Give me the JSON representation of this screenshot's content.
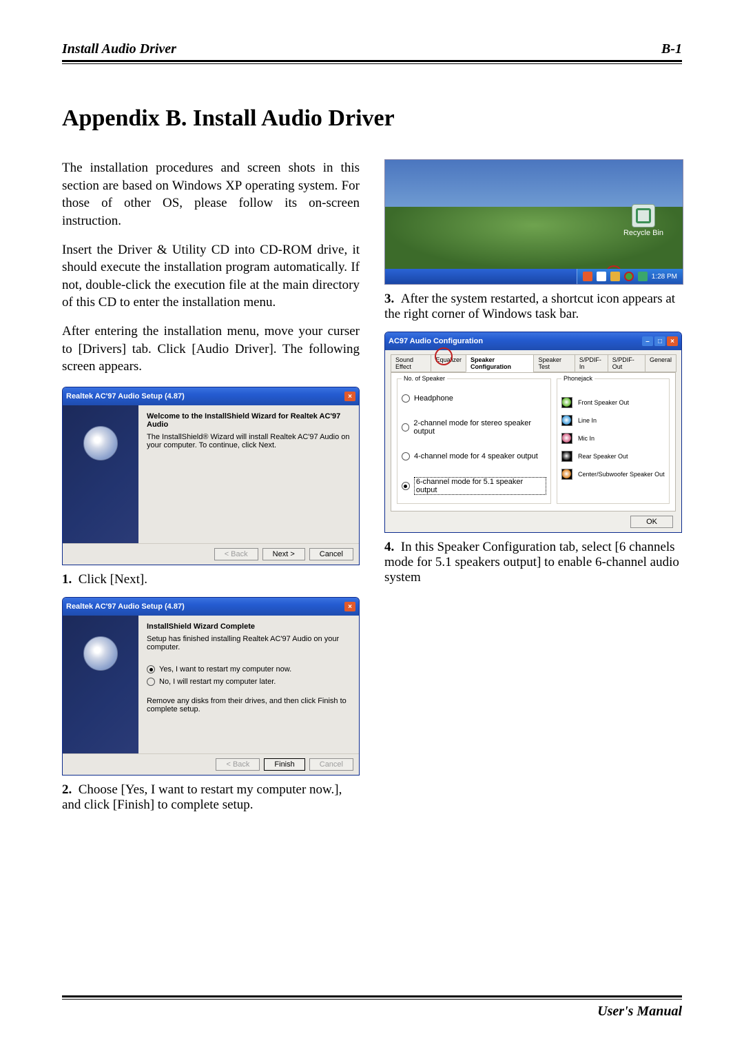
{
  "header": {
    "left": "Install Audio Driver",
    "right": "B-1"
  },
  "title": "Appendix B.   Install Audio Driver",
  "intro": [
    "The installation procedures and screen shots in this section are based on Windows XP operating system. For those of other OS, please follow its on-screen instruction.",
    "Insert the Driver & Utility CD into CD-ROM drive, it should execute the installation program automatically. If not, double-click the execution file at the main directory of this CD to enter the installation menu.",
    "After entering the installation menu, move your curser to [Drivers] tab. Click [Audio Driver]. The following screen appears."
  ],
  "steps": {
    "s1": {
      "num": "1.",
      "text": "Click [Next]."
    },
    "s2": {
      "num": "2.",
      "text": "Choose [Yes, I want to restart my computer now.], and click [Finish] to complete setup."
    },
    "s3": {
      "num": "3.",
      "text": "After the system restarted, a shortcut icon appears at the right corner of Windows task bar."
    },
    "s4": {
      "num": "4.",
      "text": "In this Speaker Configuration tab, select [6 channels mode for 5.1 speakers output] to enable 6-channel audio system"
    }
  },
  "wiz1": {
    "title": "Realtek AC'97 Audio Setup (4.87)",
    "heading": "Welcome to the InstallShield Wizard for Realtek AC'97 Audio",
    "body": "The InstallShield® Wizard will install Realtek AC'97 Audio on your computer. To continue, click Next.",
    "buttons": {
      "back": "< Back",
      "next": "Next >",
      "cancel": "Cancel"
    }
  },
  "wiz2": {
    "title": "Realtek AC'97 Audio Setup (4.87)",
    "heading": "InstallShield Wizard Complete",
    "body": "Setup has finished installing Realtek AC'97 Audio on your computer.",
    "opt_yes": "Yes, I want to restart my computer now.",
    "opt_no": "No, I will restart my computer later.",
    "note": "Remove any disks from their drives, and then click Finish to complete setup.",
    "buttons": {
      "back": "< Back",
      "finish": "Finish",
      "cancel": "Cancel"
    }
  },
  "desktop": {
    "recycle": "Recycle Bin",
    "clock": "1:28 PM"
  },
  "cfg": {
    "title": "AC97 Audio Configuration",
    "tabs": [
      "Sound Effect",
      "Equalizer",
      "Speaker Configuration",
      "Speaker Test",
      "S/PDIF-In",
      "S/PDIF-Out",
      "General"
    ],
    "active_tab": 2,
    "group_left": "No. of Speaker",
    "group_right": "Phonejack",
    "options": {
      "o1": "Headphone",
      "o2": "2-channel mode for stereo speaker output",
      "o3": "4-channel mode for 4 speaker output",
      "o4": "6-channel mode for 5.1 speaker output"
    },
    "jacks": {
      "j1": {
        "label": "Front Speaker Out",
        "color": "#6fbf3f"
      },
      "j2": {
        "label": "Line In",
        "color": "#4aa3e0"
      },
      "j3": {
        "label": "Mic In",
        "color": "#d66a8c"
      },
      "j4": {
        "label": "Rear Speaker Out",
        "color": "#222"
      },
      "j5": {
        "label": "Center/Subwoofer Speaker Out",
        "color": "#e08a2f"
      }
    },
    "ok": "OK"
  },
  "footer": "User's Manual"
}
